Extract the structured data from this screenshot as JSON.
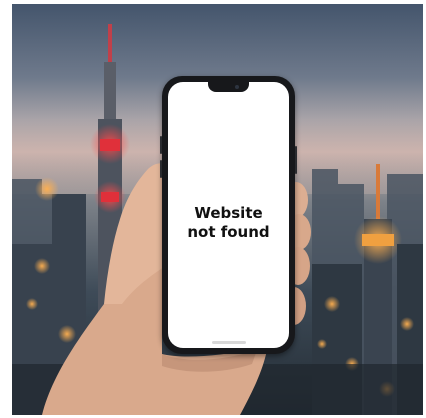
{
  "scene": {
    "description_icons": [
      "city-skyline",
      "phone",
      "hand"
    ],
    "colors": {
      "sky_top": "#44556c",
      "sky_glow": "#cdb3ad",
      "tower_light": "#e0303a",
      "city_light": "#f0a040",
      "phone_body": "#17181b",
      "screen": "#ffffff",
      "skin": "#e0b394"
    }
  },
  "phone": {
    "message_line1": "Website",
    "message_line2": "not found"
  }
}
